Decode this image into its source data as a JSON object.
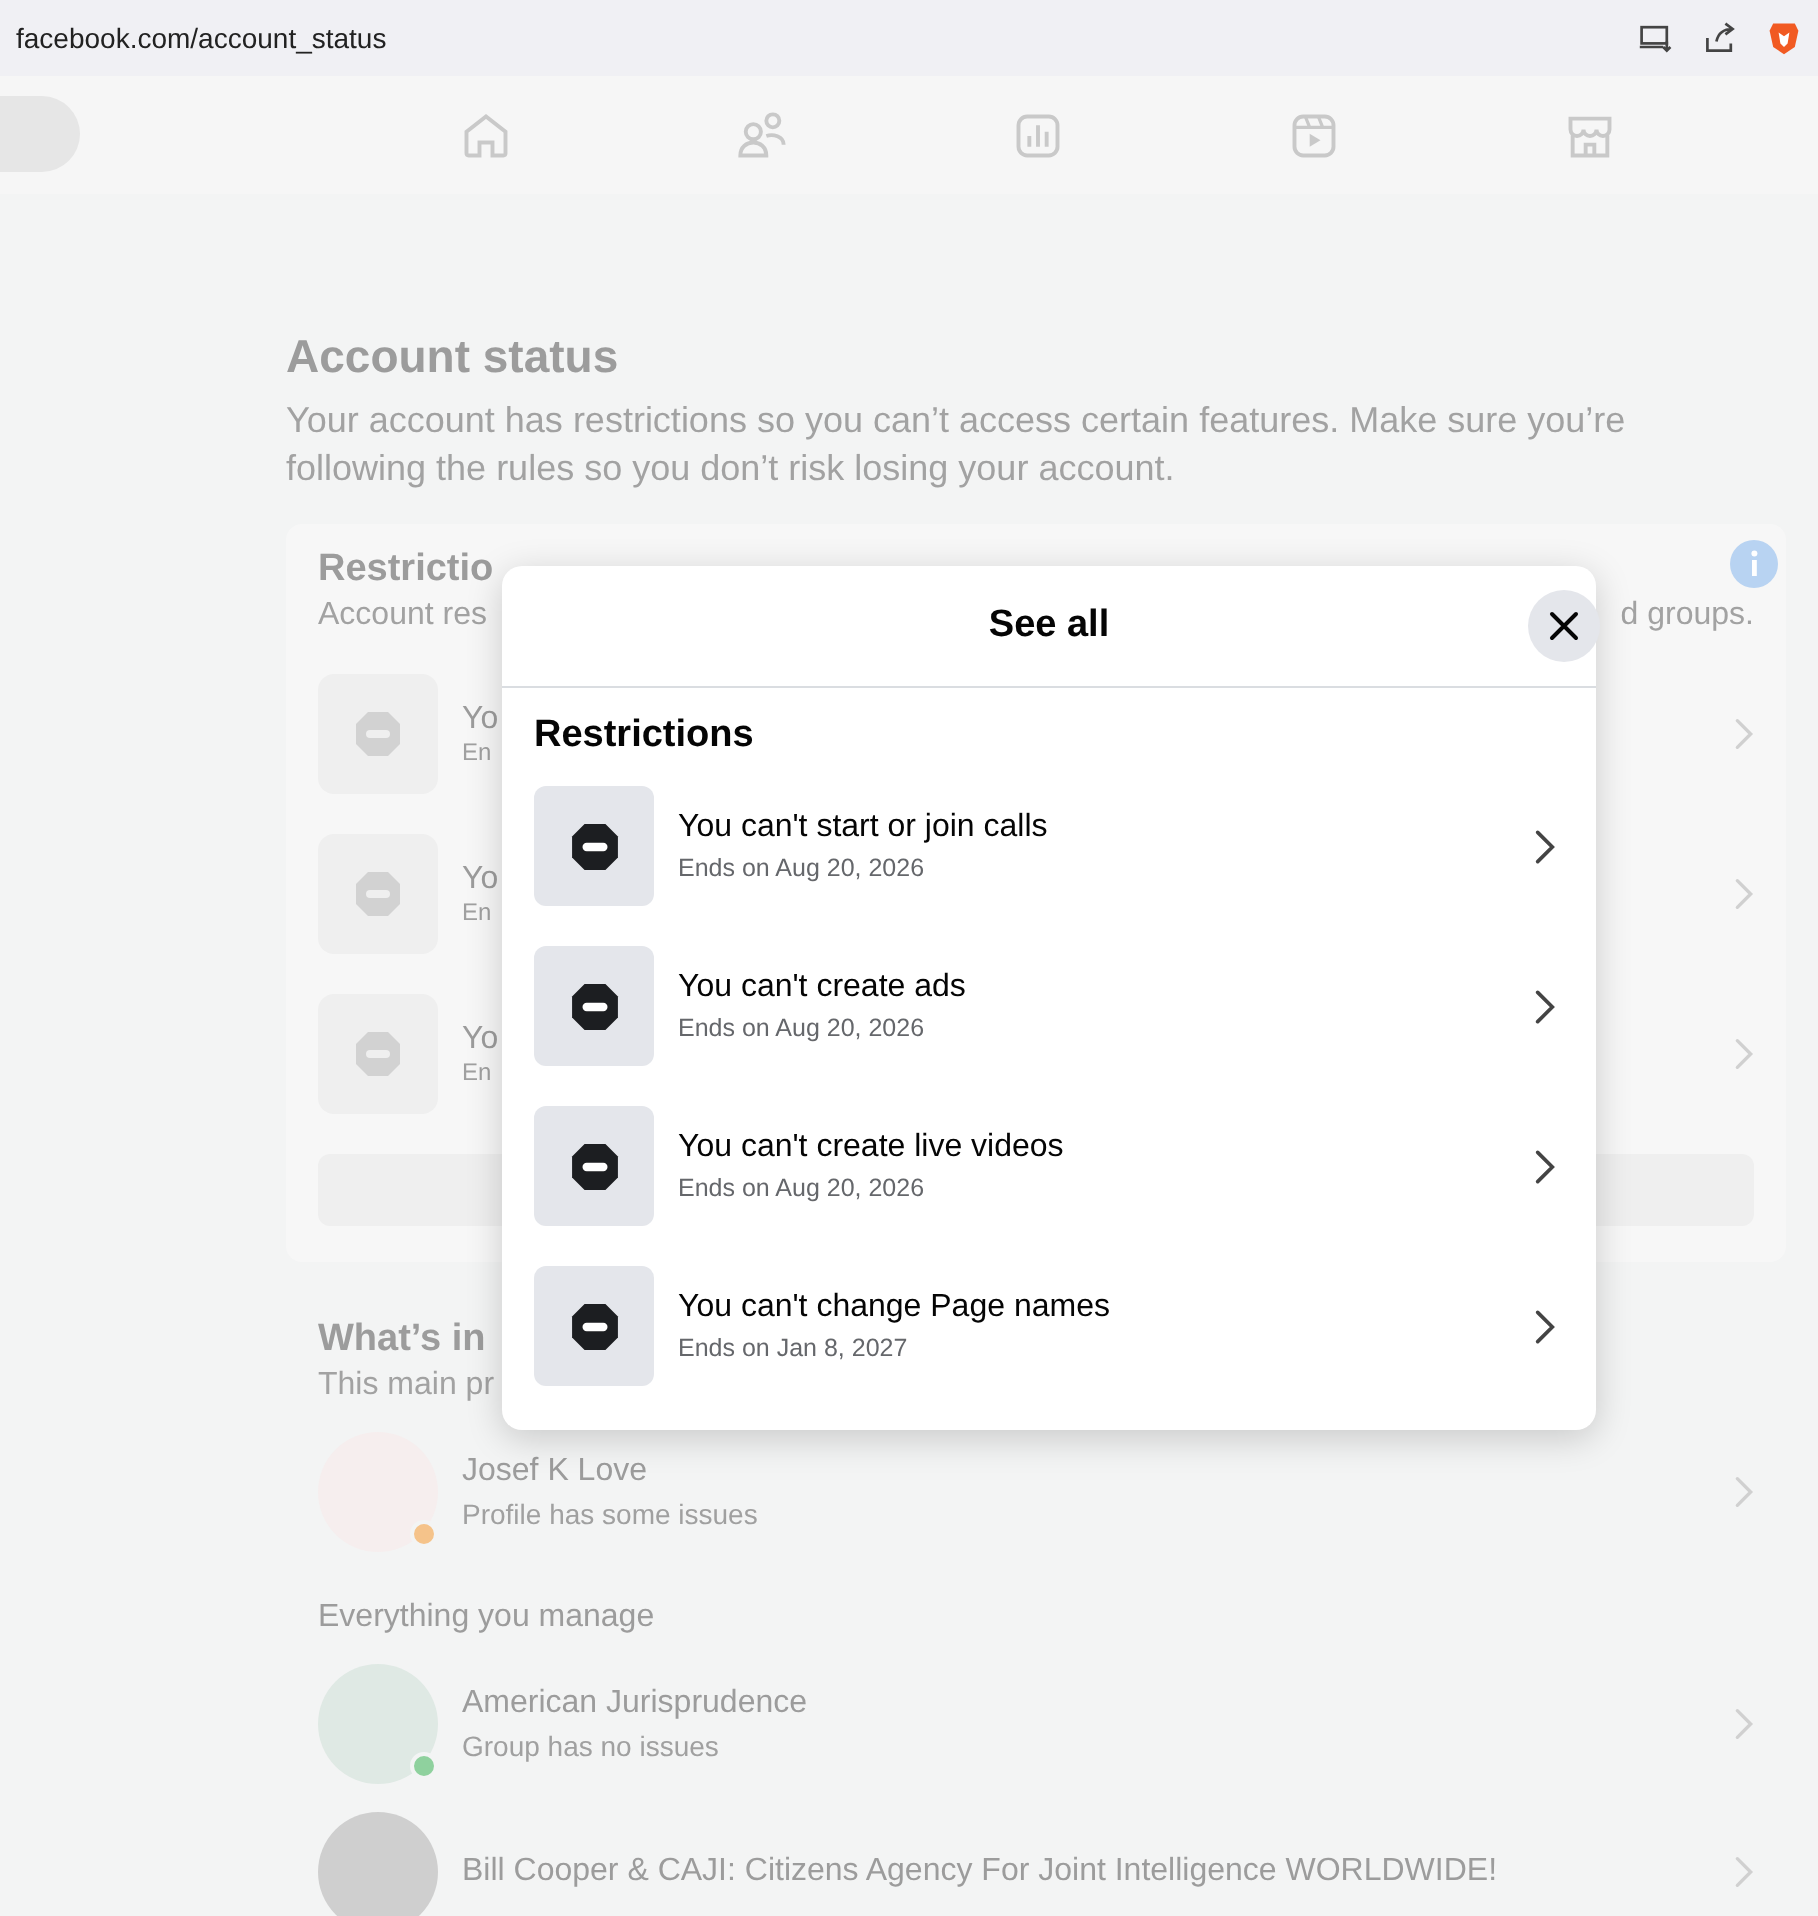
{
  "browser": {
    "url": "facebook.com/account_status"
  },
  "page": {
    "title": "Account status",
    "description": "Your account has restrictions so you can’t access certain features. Make sure you’re following the rules so you don’t risk losing your account.",
    "restrictions_card": {
      "title": "Restrictio",
      "subtitle_start": "Account res",
      "subtitle_end": "d groups.",
      "items": [
        {
          "title": "Yo",
          "subtitle": "En"
        },
        {
          "title": "Yo",
          "subtitle": "En"
        },
        {
          "title": "Yo",
          "subtitle": "En"
        }
      ]
    },
    "main_profile": {
      "title": "What’s in",
      "subtitle": "This main pr",
      "profile": {
        "name": "Josef K Love",
        "status": "Profile has some issues",
        "color": "#f5c38a"
      }
    },
    "managed": {
      "title": "Everything you manage",
      "items": [
        {
          "name": "American Jurisprudence",
          "status": "Group has no issues",
          "color": "#8fd19e"
        },
        {
          "name": "Bill Cooper & CAJI: Citizens Agency For Joint Intelligence WORLDWIDE!"
        }
      ]
    }
  },
  "modal": {
    "title": "See all",
    "section": "Restrictions",
    "items": [
      {
        "title": "You can't start or join calls",
        "subtitle": "Ends on Aug 20, 2026"
      },
      {
        "title": "You can't create ads",
        "subtitle": "Ends on Aug 20, 2026"
      },
      {
        "title": "You can't create live videos",
        "subtitle": "Ends on Aug 20, 2026"
      },
      {
        "title": "You can't change Page names",
        "subtitle": "Ends on Jan 8, 2027"
      }
    ]
  }
}
